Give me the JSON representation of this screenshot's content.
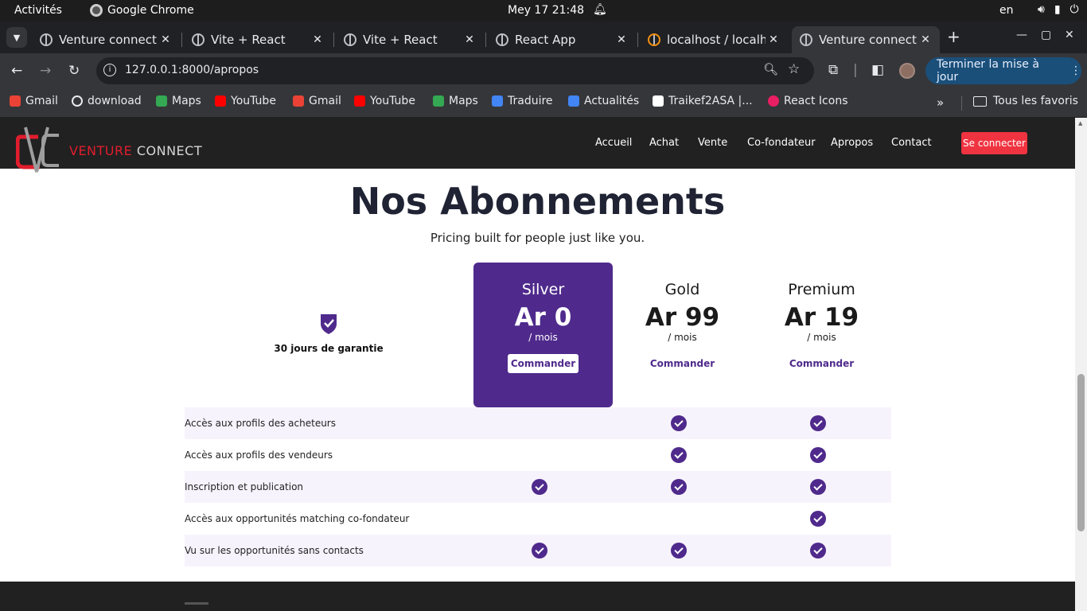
{
  "system_bar": {
    "activities": "Activités",
    "app_name": "Google Chrome",
    "clock": "Mey 17  21:48",
    "language": "en"
  },
  "tabs": [
    {
      "title": "Venture connect",
      "active": false
    },
    {
      "title": "Vite + React",
      "active": false
    },
    {
      "title": "Vite + React",
      "active": false
    },
    {
      "title": "React App",
      "active": false
    },
    {
      "title": "localhost / localhost",
      "active": false
    },
    {
      "title": "Venture connect",
      "active": true
    }
  ],
  "toolbar": {
    "url": "127.0.0.1:8000/apropos",
    "update_button": "Terminer la mise à jour"
  },
  "bookmarks": {
    "items": [
      "Gmail",
      "download",
      "Maps",
      "YouTube",
      "Gmail",
      "YouTube",
      "Maps",
      "Traduire",
      "Actualités",
      "Traikef2ASA |...",
      "React Icons"
    ],
    "all_label": "Tous les favoris"
  },
  "site": {
    "logo_text_red": "VENTURE",
    "logo_text_gray": "CONNECT",
    "nav": [
      "Accueil",
      "Achat",
      "Vente",
      "Co-fondateur",
      "Apropos",
      "Contact"
    ],
    "login": "Se connecter"
  },
  "pricing": {
    "title": "Nos Abonnements",
    "subtitle": "Pricing built for people just like you.",
    "guarantee": "30 jours de garantie",
    "plans": [
      {
        "name": "Silver",
        "price": "Ar 0",
        "period": "/ mois",
        "cta": "Commander"
      },
      {
        "name": "Gold",
        "price": "Ar 99",
        "period": "/ mois",
        "cta": "Commander"
      },
      {
        "name": "Premium",
        "price": "Ar 19",
        "period": "/ mois",
        "cta": "Commander"
      }
    ],
    "features": [
      {
        "label": "Accès aux profils des acheteurs",
        "silver": false,
        "gold": true,
        "premium": true
      },
      {
        "label": "Accès aux profils des vendeurs",
        "silver": false,
        "gold": true,
        "premium": true
      },
      {
        "label": "Inscription et publication",
        "silver": true,
        "gold": true,
        "premium": true
      },
      {
        "label": "Accès aux opportunités matching co-fondateur",
        "silver": false,
        "gold": false,
        "premium": true
      },
      {
        "label": "Vu sur les opportunités sans contacts",
        "silver": true,
        "gold": true,
        "premium": true
      }
    ]
  },
  "colors": {
    "accent": "#4f2a8c",
    "brand_red": "#e11d2d",
    "nav_bg": "#212121",
    "row_shade": "#f7f3fd"
  }
}
